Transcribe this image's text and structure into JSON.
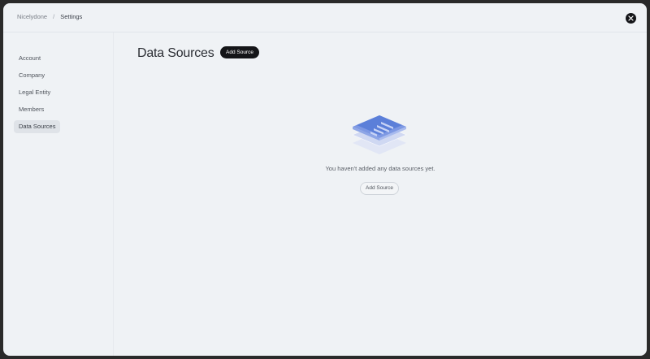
{
  "breadcrumb": {
    "workspace": "Nicelydone",
    "separator": "/",
    "current": "Settings"
  },
  "sidebar": {
    "items": [
      {
        "label": "Account",
        "active": false
      },
      {
        "label": "Company",
        "active": false
      },
      {
        "label": "Legal Entity",
        "active": false
      },
      {
        "label": "Members",
        "active": false
      },
      {
        "label": "Data Sources",
        "active": true
      }
    ]
  },
  "main": {
    "title": "Data Sources",
    "header_button_label": "Add Source",
    "empty_state": {
      "message": "You haven't added any data sources yet.",
      "button_label": "Add Source",
      "illustration_icon": "stacked-data-layers-icon"
    }
  },
  "icons": {
    "close": "close-icon"
  },
  "colors": {
    "background": "#eff2f5",
    "primary_button": "#141518",
    "illustration_accent": "#5b7fd9"
  }
}
